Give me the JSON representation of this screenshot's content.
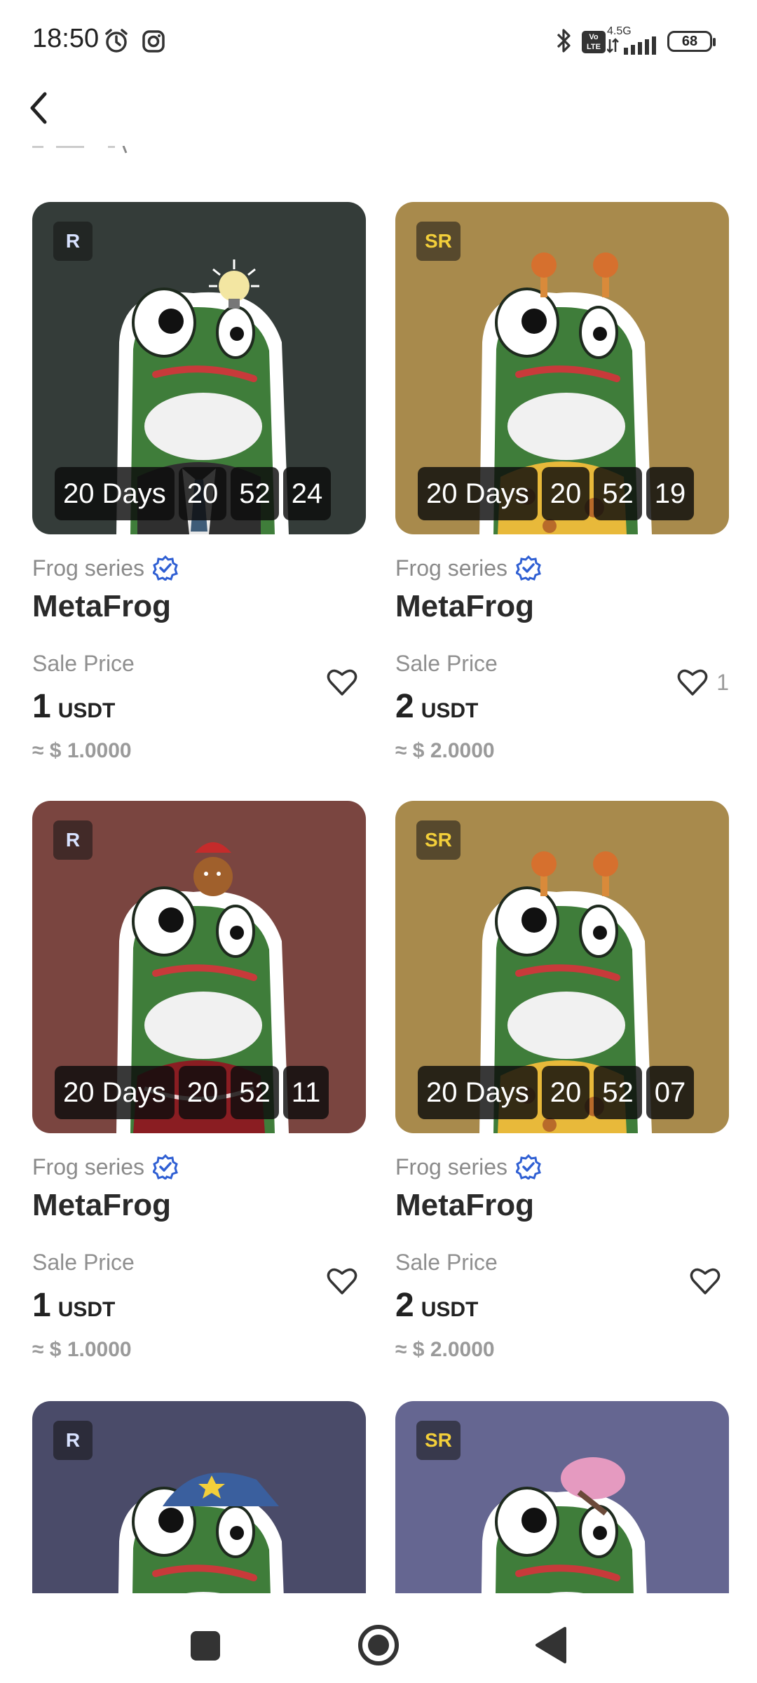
{
  "status": {
    "time": "18:50",
    "network": "4.5G",
    "volte": "Vo LTE",
    "battery": "68"
  },
  "labels": {
    "price_label": "Sale Price"
  },
  "items": [
    {
      "rarity": "R",
      "series": "Frog series",
      "name": "MetaFrog",
      "price": "1",
      "currency": "USDT",
      "approx": "≈ $ 1.0000",
      "likes": "",
      "timer": [
        "20 Days",
        "20",
        "52",
        "24"
      ],
      "bg": "#343c39",
      "outfit": "suit"
    },
    {
      "rarity": "SR",
      "series": "Frog series",
      "name": "MetaFrog",
      "price": "2",
      "currency": "USDT",
      "approx": "≈ $ 2.0000",
      "likes": "1",
      "timer": [
        "20 Days",
        "20",
        "52",
        "19"
      ],
      "bg": "#a88a4c",
      "outfit": "giraffe"
    },
    {
      "rarity": "R",
      "series": "Frog series",
      "name": "MetaFrog",
      "price": "1",
      "currency": "USDT",
      "approx": "≈ $ 1.0000",
      "likes": "",
      "timer": [
        "20 Days",
        "20",
        "52",
        "11"
      ],
      "bg": "#7a4540",
      "outfit": "sweater"
    },
    {
      "rarity": "SR",
      "series": "Frog series",
      "name": "MetaFrog",
      "price": "2",
      "currency": "USDT",
      "approx": "≈ $ 2.0000",
      "likes": "",
      "timer": [
        "20 Days",
        "20",
        "52",
        "07"
      ],
      "bg": "#a88a4c",
      "outfit": "giraffe"
    },
    {
      "rarity": "R",
      "bg": "#4a4b69",
      "outfit": "cap"
    },
    {
      "rarity": "SR",
      "bg": "#656691",
      "outfit": "icecream"
    }
  ],
  "icons": {
    "back": "back-arrow-icon",
    "verified": "verified-badge-icon",
    "like": "heart-icon"
  },
  "colors": {
    "verified": "#2f5fd3",
    "sr": "#f3cf3a"
  }
}
